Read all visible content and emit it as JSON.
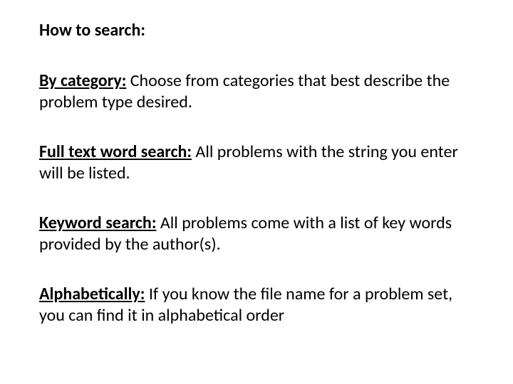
{
  "heading": "How to search:",
  "sections": [
    {
      "label": "By category",
      "text": " Choose from categories that best describe the problem type desired."
    },
    {
      "label": "Full text word search",
      "text": " All problems with the string you enter will be listed."
    },
    {
      "label": "Keyword search",
      "text": " All problems come with a list of key words provided by the author(s)."
    },
    {
      "label": "Alphabetically",
      "text": " If you know the file name for a problem set, you can find it in alphabetical order"
    }
  ]
}
